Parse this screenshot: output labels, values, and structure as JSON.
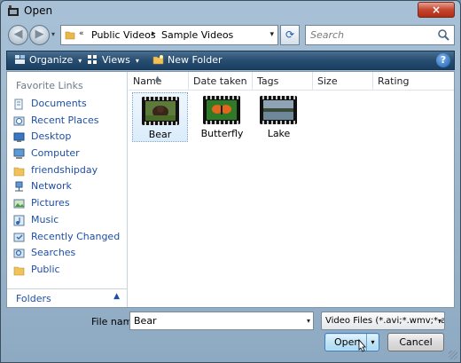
{
  "window": {
    "title": "Open",
    "close_glyph": "×"
  },
  "nav": {
    "back_glyph": "◀",
    "forward_glyph": "▶",
    "dropdown_glyph": "▾"
  },
  "address": {
    "prefix": "«",
    "segments": [
      "Public Videos",
      "Sample Videos"
    ],
    "separator": "▸",
    "dropdown_glyph": "▾"
  },
  "refresh_glyph": "⟳",
  "search": {
    "placeholder": "Search"
  },
  "toolbar": {
    "organize": "Organize",
    "views": "Views",
    "new_folder": "New Folder",
    "help": "?",
    "arrow": "▾"
  },
  "sidebar": {
    "title": "Favorite Links",
    "items": [
      {
        "label": "Documents",
        "icon": "documents-icon"
      },
      {
        "label": "Recent Places",
        "icon": "recent-places-icon"
      },
      {
        "label": "Desktop",
        "icon": "desktop-icon"
      },
      {
        "label": "Computer",
        "icon": "computer-icon"
      },
      {
        "label": "friendshipday",
        "icon": "folder-icon"
      },
      {
        "label": "Network",
        "icon": "network-icon"
      },
      {
        "label": "Pictures",
        "icon": "pictures-icon"
      },
      {
        "label": "Music",
        "icon": "music-icon"
      },
      {
        "label": "Recently Changed",
        "icon": "recently-changed-icon"
      },
      {
        "label": "Searches",
        "icon": "searches-icon"
      },
      {
        "label": "Public",
        "icon": "folder-icon"
      }
    ],
    "folders_label": "Folders",
    "collapse_glyph": "▲"
  },
  "columns": [
    "Name",
    "Date taken",
    "Tags",
    "Size",
    "Rating"
  ],
  "sort_glyph": "▲",
  "files": [
    {
      "name": "Bear",
      "selected": true
    },
    {
      "name": "Butterfly",
      "selected": false
    },
    {
      "name": "Lake",
      "selected": false
    }
  ],
  "bottom": {
    "file_name_label": "File name:",
    "file_name_value": "Bear",
    "filter_value": "Video Files (*.avi;*.wmv;*.asf;",
    "dropdown_glyph": "▾",
    "open_label": "Open",
    "cancel_label": "Cancel"
  },
  "colors": {
    "toolbar": "#274d70",
    "link": "#1e4fa3",
    "selection": "#dbecfb"
  }
}
